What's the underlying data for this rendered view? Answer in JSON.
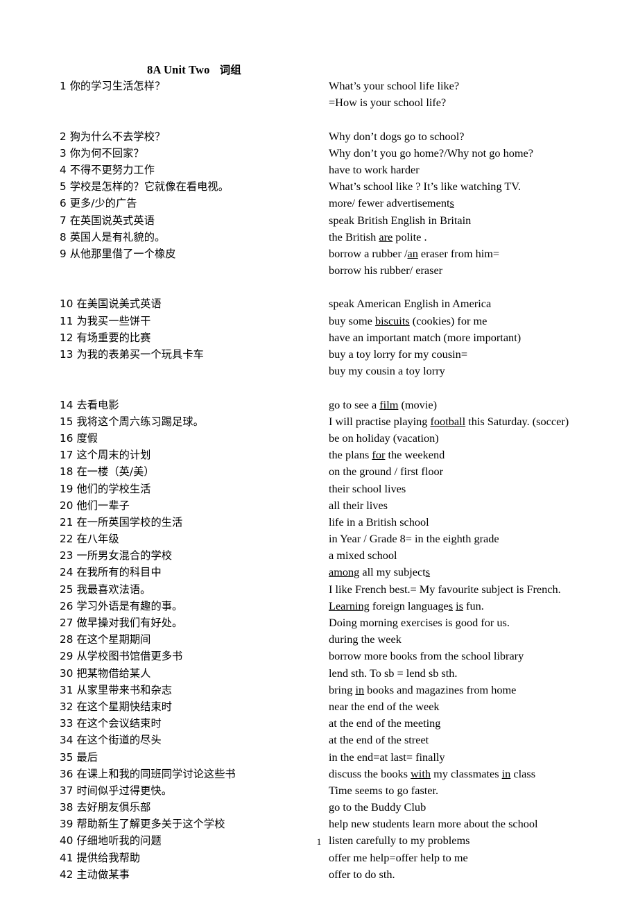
{
  "document": {
    "title_en": "8A Unit Two",
    "title_cn": "词组",
    "page_number": "1"
  },
  "rows": [
    {
      "cn": "1  你的学习生活怎样？",
      "en": "What’s your school life like?"
    },
    {
      "cn": "",
      "en": "=How is your school life?"
    },
    {
      "cn": "",
      "en": ""
    },
    {
      "cn": "2  狗为什么不去学校？",
      "en": "Why don’t dogs go to school?"
    },
    {
      "cn": "3  你为何不回家？",
      "en": "Why don’t you go home?/Why not go home?"
    },
    {
      "cn": "4 不得不更努力工作",
      "en": "have to work harder"
    },
    {
      "cn": "5  学校是怎样的？它就像在看电视。",
      "en": "What’s school like ? It’s like watching TV."
    },
    {
      "cn": "6 更多/少的广告",
      "en": "more/ fewer advertisement<u>s</u>"
    },
    {
      "cn": "7  在英国说英式英语",
      "en": "speak British English in Britain"
    },
    {
      "cn": "8 英国人是有礼貌的。",
      "en": "the British <u>are</u> polite ."
    },
    {
      "cn": "9 从他那里借了一个橡皮",
      "en": "borrow a rubber /<u>an</u> eraser from him="
    },
    {
      "cn": "",
      "en": "borrow his rubber/ eraser"
    },
    {
      "cn": "",
      "en": ""
    },
    {
      "cn": "10  在美国说美式英语",
      "en": "speak American English in America"
    },
    {
      "cn": "11  为我买一些饼干",
      "en": "buy some <u>biscuits</u> (cookies) for me"
    },
    {
      "cn": "12  有场重要的比赛",
      "en": "have an important match (more important)"
    },
    {
      "cn": "13  为我的表弟买一个玩具卡车",
      "en": "buy a toy lorry for my cousin="
    },
    {
      "cn": "",
      "en": "buy my cousin a toy lorry"
    },
    {
      "cn": "",
      "en": ""
    },
    {
      "cn": "14 去看电影",
      "en": "go to   see a <u>film</u>   (movie)"
    },
    {
      "cn": "15  我将这个周六练习踢足球。",
      "en": "I will practise playing <u>football</u> this Saturday. (soccer)"
    },
    {
      "cn": "16  度假",
      "en": "be on holiday    (vacation)"
    },
    {
      "cn": "17  这个周末的计划",
      "en": "the plans <u>for</u> the weekend"
    },
    {
      "cn": "18 在一楼（英/美）",
      "en": "on the ground / first floor"
    },
    {
      "cn": "19  他们的学校生活",
      "en": "their school lives"
    },
    {
      "cn": "20  他们一辈子",
      "en": "all their lives"
    },
    {
      "cn": "21  在一所英国学校的生活",
      "en": "life in a British school"
    },
    {
      "cn": "22  在八年级",
      "en": "in Year / Grade 8= in the eighth grade"
    },
    {
      "cn": "23  一所男女混合的学校",
      "en": "a mixed school"
    },
    {
      "cn": "24  在我所有的科目中",
      "en": "<u>among</u> all my subject<u>s</u>"
    },
    {
      "cn": "25  我最喜欢法语。",
      "en": "I like French best.= My favourite subject is French."
    },
    {
      "cn": "26  学习外语是有趣的事。",
      "en": "<u>Learning</u> foreign language<u>s</u> <u>is</u> fun."
    },
    {
      "cn": "27  做早操对我们有好处。",
      "en": "Doing morning exercises is good for us."
    },
    {
      "cn": "28 在这个星期期间",
      "en": "during the week"
    },
    {
      "cn": "29 从学校图书馆借更多书",
      "en": "borrow more books from the school library"
    },
    {
      "cn": "30 把某物借给某人",
      "en": "lend sth. To sb = lend sb sth."
    },
    {
      "cn": "31 从家里带来书和杂志",
      "en": "bring <u>in</u> books and magazines from home"
    },
    {
      "cn": "32 在这个星期快结束时",
      "en": "near the end of the week"
    },
    {
      "cn": "33 在这个会议结束时",
      "en": "at the end of the meeting"
    },
    {
      "cn": "34 在这个街道的尽头",
      "en": "at the end of the street"
    },
    {
      "cn": "35 最后",
      "en": "in the end=at last= finally"
    },
    {
      "cn": "36 在课上和我的同班同学讨论这些书",
      "en": "discuss the books <u>with</u> my classmates <u>in</u> class"
    },
    {
      "cn": "37 时间似乎过得更快。",
      "en": "Time seems to go faster."
    },
    {
      "cn": "38 去好朋友俱乐部",
      "en": "go to the Buddy Club"
    },
    {
      "cn": "39 帮助新生了解更多关于这个学校",
      "en": "help new students learn more about the school"
    },
    {
      "cn": "40 仔细地听我的问题",
      "en": "listen carefully to my problems"
    },
    {
      "cn": "41 提供给我帮助",
      "en": "offer me help=offer help to me"
    },
    {
      "cn": "42 主动做某事",
      "en": "offer to do sth."
    }
  ]
}
